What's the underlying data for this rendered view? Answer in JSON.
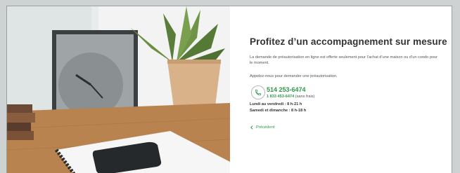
{
  "panel": {
    "title": "Profitez d’un accompagnement sur mesure",
    "description": "La demande de préautorisation en ligne est offerte seulement pour l’achat d’une maison ou d’un condo pour le moment.",
    "call_prompt": "Appelez-nous pour demander une préautorisation.",
    "phone_main": "514 253-6474",
    "phone_tollfree": "1 833 453-6474",
    "phone_tollfree_note": " (sans frais)",
    "hours_weekday": "Lundi au vendredi : 8 h-21 h",
    "hours_weekend": "Samedi et dimanche : 8 h-18 h",
    "back_label": "Précédent"
  },
  "colors": {
    "accent": "#2d9a4a",
    "title": "#333333",
    "body_text": "#555555",
    "backdrop": "#cfd2d2"
  },
  "icons": {
    "phone": "phone-icon",
    "back": "chevron-left-icon"
  }
}
